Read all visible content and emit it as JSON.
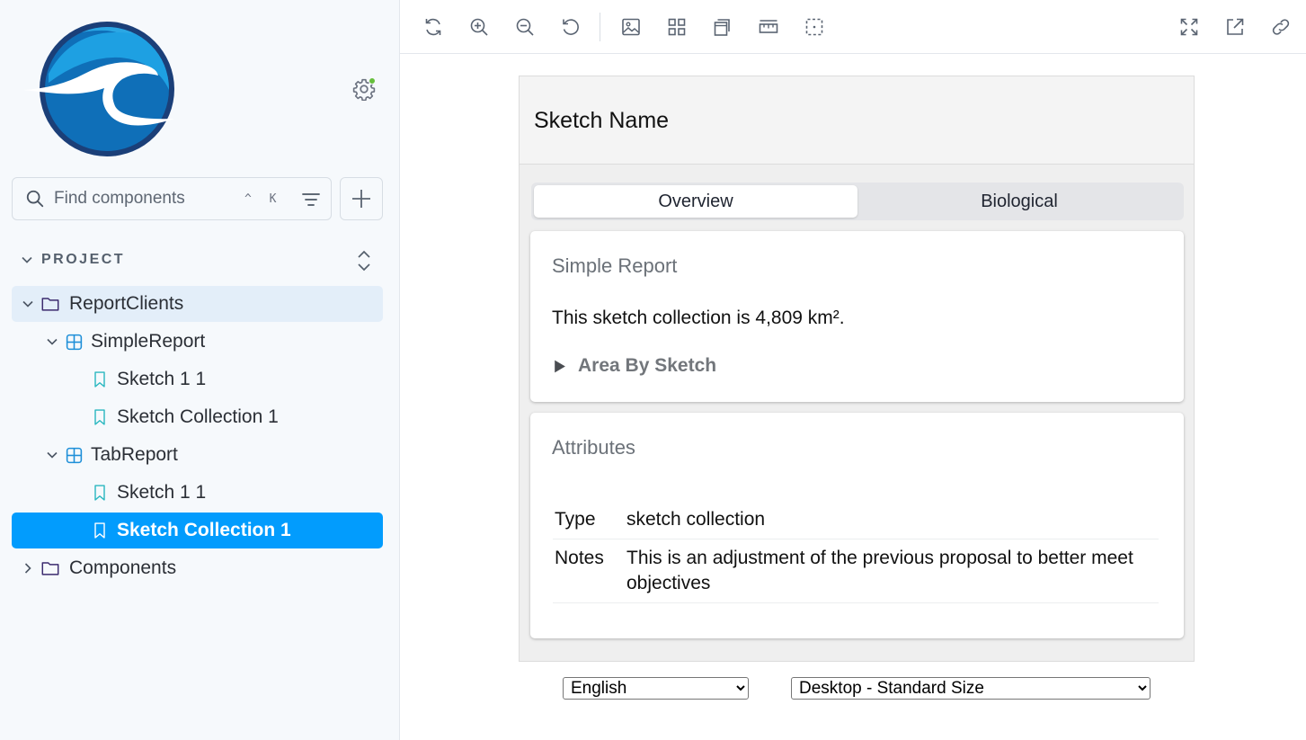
{
  "sidebar": {
    "search": {
      "placeholder": "Find components",
      "shortcut": "^ K"
    },
    "section_title": "PROJECT",
    "tree": [
      {
        "label": "ReportClients",
        "type": "folder",
        "expanded": true
      },
      {
        "label": "SimpleReport",
        "type": "component",
        "expanded": true
      },
      {
        "label": "Sketch 1 1",
        "type": "story"
      },
      {
        "label": "Sketch Collection 1",
        "type": "story"
      },
      {
        "label": "TabReport",
        "type": "component",
        "expanded": true
      },
      {
        "label": "Sketch 1 1",
        "type": "story"
      },
      {
        "label": "Sketch Collection 1",
        "type": "story",
        "selected": true
      },
      {
        "label": "Components",
        "type": "folder",
        "expanded": false
      }
    ]
  },
  "toolbar": {
    "left_icons": [
      "reload-icon",
      "zoom-in-icon",
      "zoom-out-icon",
      "reset-zoom-icon",
      "background-icon",
      "grid-icon",
      "outline-icon",
      "measure-icon",
      "viewport-icon"
    ],
    "right_icons": [
      "fullscreen-icon",
      "open-new-tab-icon",
      "copy-link-icon"
    ]
  },
  "report": {
    "title": "Sketch Name",
    "tabs": [
      "Overview",
      "Biological"
    ],
    "active_tab": "Overview",
    "simple_card": {
      "title": "Simple Report",
      "text": "This sketch collection is 4,809 km².",
      "toggle_label": "Area By Sketch"
    },
    "attributes_card": {
      "title": "Attributes",
      "rows": [
        {
          "key": "Type",
          "value": "sketch collection"
        },
        {
          "key": "Notes",
          "value": "This is an adjustment of the previous proposal to better meet objectives"
        }
      ]
    }
  },
  "controls": {
    "language": {
      "value": "English"
    },
    "viewport": {
      "value": "Desktop - Standard Size"
    }
  },
  "colors": {
    "accent": "#029cfd",
    "active_folder_bg": "#e3eef9",
    "status_dot": "#66bf3c"
  }
}
